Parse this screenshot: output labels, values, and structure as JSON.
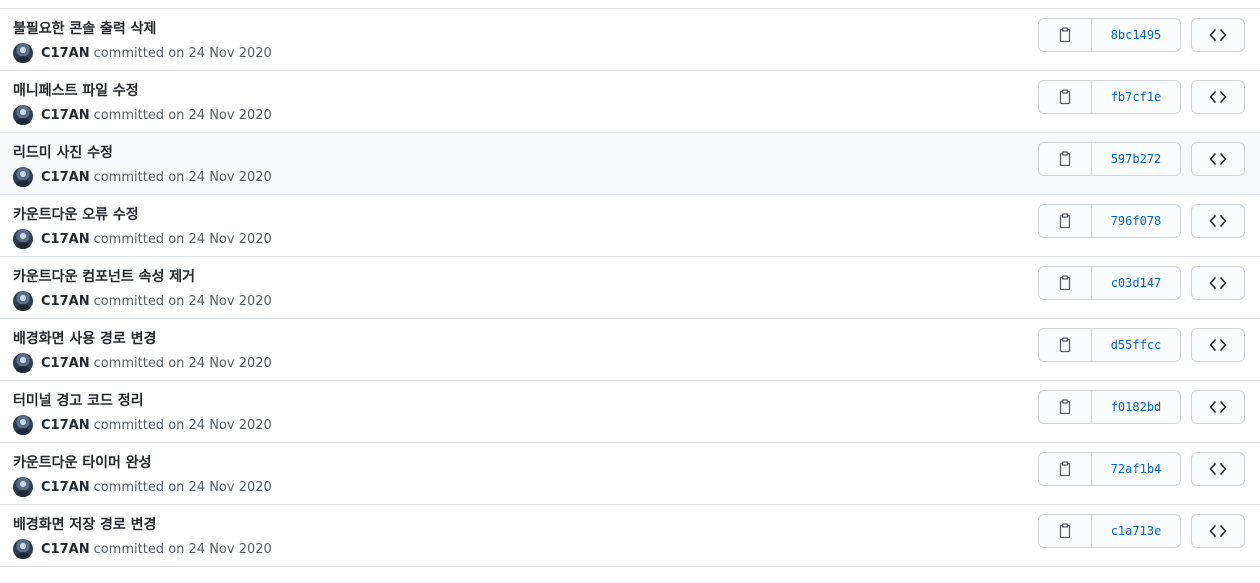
{
  "commits": [
    {
      "title": "불필요한 콘솔 출력 삭제",
      "author": "C17AN",
      "meta": "committed on 24 Nov 2020",
      "sha": "8bc1495"
    },
    {
      "title": "매니페스트 파일 수정",
      "author": "C17AN",
      "meta": "committed on 24 Nov 2020",
      "sha": "fb7cf1e"
    },
    {
      "title": "리드미 사진 수정",
      "author": "C17AN",
      "meta": "committed on 24 Nov 2020",
      "sha": "597b272"
    },
    {
      "title": "카운트다운 오류 수정",
      "author": "C17AN",
      "meta": "committed on 24 Nov 2020",
      "sha": "796f078"
    },
    {
      "title": "카운트다운 컴포넌트 속성 제거",
      "author": "C17AN",
      "meta": "committed on 24 Nov 2020",
      "sha": "c03d147"
    },
    {
      "title": "배경화면 사용 경로 변경",
      "author": "C17AN",
      "meta": "committed on 24 Nov 2020",
      "sha": "d55ffcc"
    },
    {
      "title": "터미널 경고 코드 정리",
      "author": "C17AN",
      "meta": "committed on 24 Nov 2020",
      "sha": "f0182bd"
    },
    {
      "title": "카운트다운 타이머 완성",
      "author": "C17AN",
      "meta": "committed on 24 Nov 2020",
      "sha": "72af1b4"
    },
    {
      "title": "배경화면 저장 경로 변경",
      "author": "C17AN",
      "meta": "committed on 24 Nov 2020",
      "sha": "c1a713e"
    }
  ],
  "icons": {
    "copy": "clipboard-icon",
    "browse": "code-icon"
  },
  "colors": {
    "sha_link": "#0366d6",
    "border": "#e1e4e8",
    "hover_row": "#f6f8fa"
  }
}
